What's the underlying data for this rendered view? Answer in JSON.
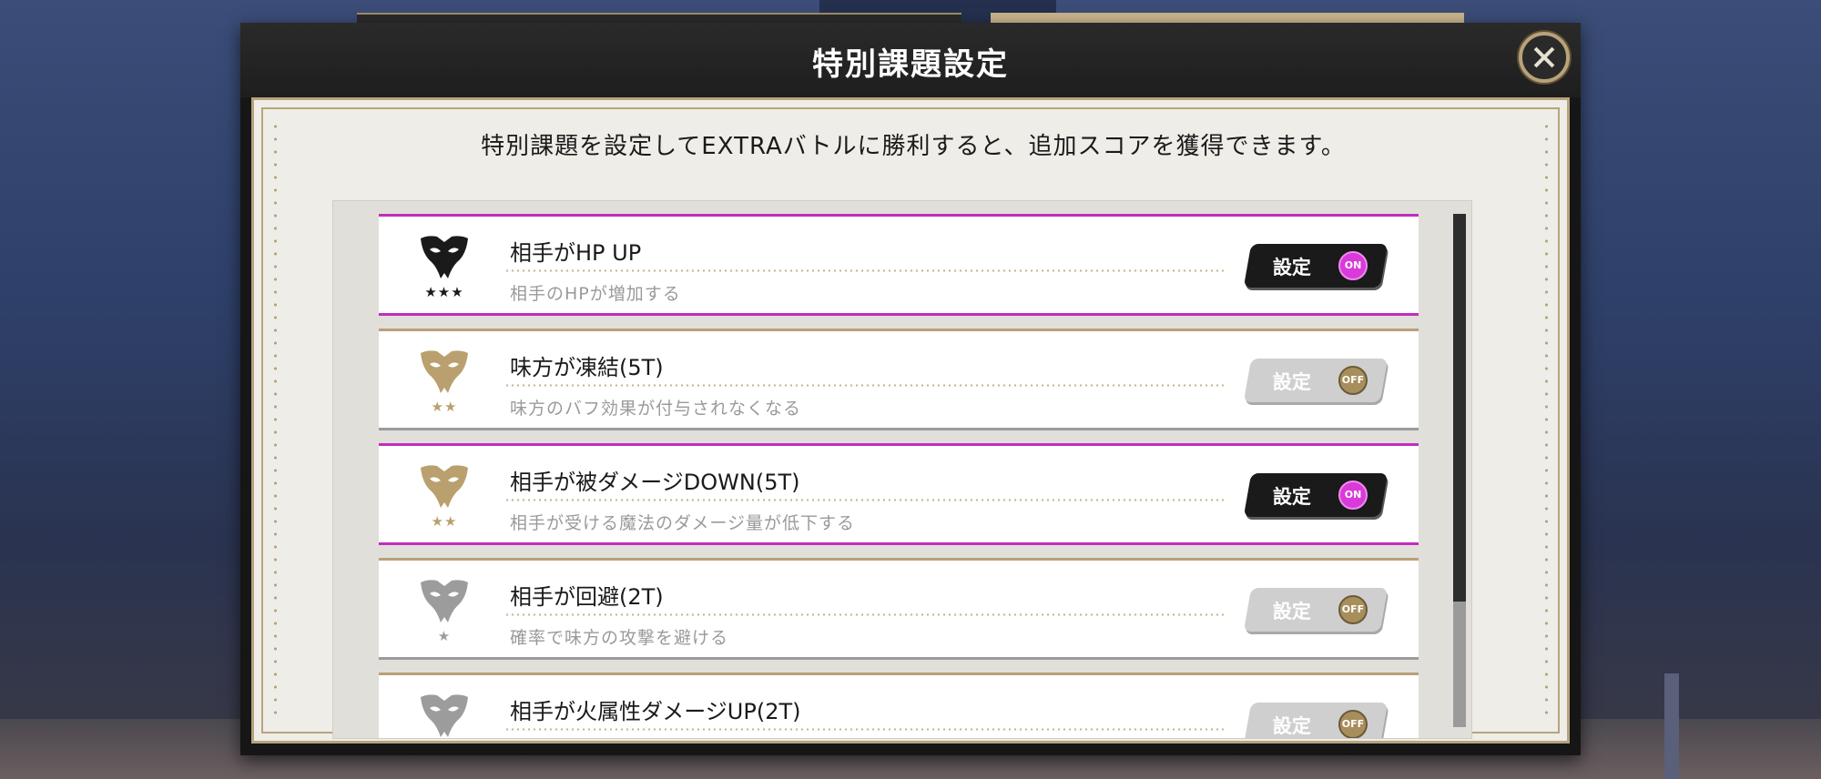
{
  "dialog": {
    "title": "特別課題設定",
    "intro": "特別課題を設定してEXTRAバトルに勝利すると、追加スコアを獲得できます。"
  },
  "items": [
    {
      "title": "相手がHP UP",
      "desc": "相手のHPが増加する",
      "stars": "★★★",
      "mask_color": "#1a1a1a",
      "toggle_label": "設定",
      "toggle_state": "ON"
    },
    {
      "title": "味方が凍結(5T)",
      "desc": "味方のバフ効果が付与されなくなる",
      "stars": "★★",
      "mask_color": "#b9a06e",
      "toggle_label": "設定",
      "toggle_state": "OFF"
    },
    {
      "title": "相手が被ダメージDOWN(5T)",
      "desc": "相手が受ける魔法のダメージ量が低下する",
      "stars": "★★",
      "mask_color": "#b9a06e",
      "toggle_label": "設定",
      "toggle_state": "ON"
    },
    {
      "title": "相手が回避(2T)",
      "desc": "確率で味方の攻撃を避ける",
      "stars": "★",
      "mask_color": "#9c9c9c",
      "toggle_label": "設定",
      "toggle_state": "OFF"
    },
    {
      "title": "相手が火属性ダメージUP(2T)",
      "desc": "",
      "stars": "",
      "mask_color": "#9c9c9c",
      "toggle_label": "設定",
      "toggle_state": "OFF"
    }
  ],
  "colors": {
    "accent_on": "#c02ec0",
    "accent_off": "#b9a07a",
    "gold": "#b7a47d"
  },
  "icons": {
    "close": "close-icon",
    "mask": "mask-icon"
  }
}
